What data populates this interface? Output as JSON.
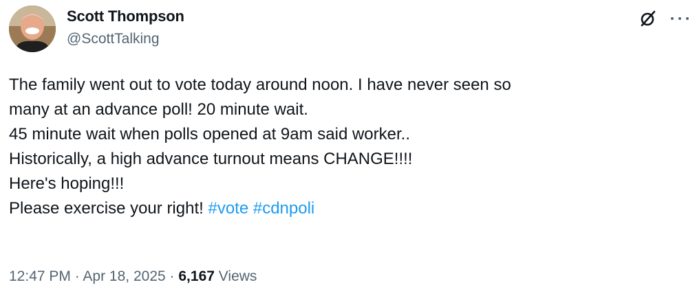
{
  "author": {
    "name": "Scott Thompson",
    "handle": "@ScottTalking"
  },
  "icons": {
    "grok": "grok-icon",
    "more": "more-options-icon",
    "avatar": "profile-avatar"
  },
  "tweet": {
    "lines": [
      "The family went out to vote today around noon. I have never seen so",
      "many at an advance poll! 20 minute wait.",
      "45 minute wait when polls opened at 9am said worker..",
      "Historically, a high advance turnout means CHANGE!!!!",
      "Here's hoping!!!",
      "Please exercise your right!"
    ],
    "hashtags": [
      "#vote",
      "#cdnpoli"
    ]
  },
  "meta": {
    "time": "12:47 PM",
    "separator": "·",
    "date": "Apr 18, 2025",
    "views_count": "6,167",
    "views_label": "Views"
  },
  "colors": {
    "text": "#0f1419",
    "secondary": "#536471",
    "link": "#1d9bf0"
  }
}
